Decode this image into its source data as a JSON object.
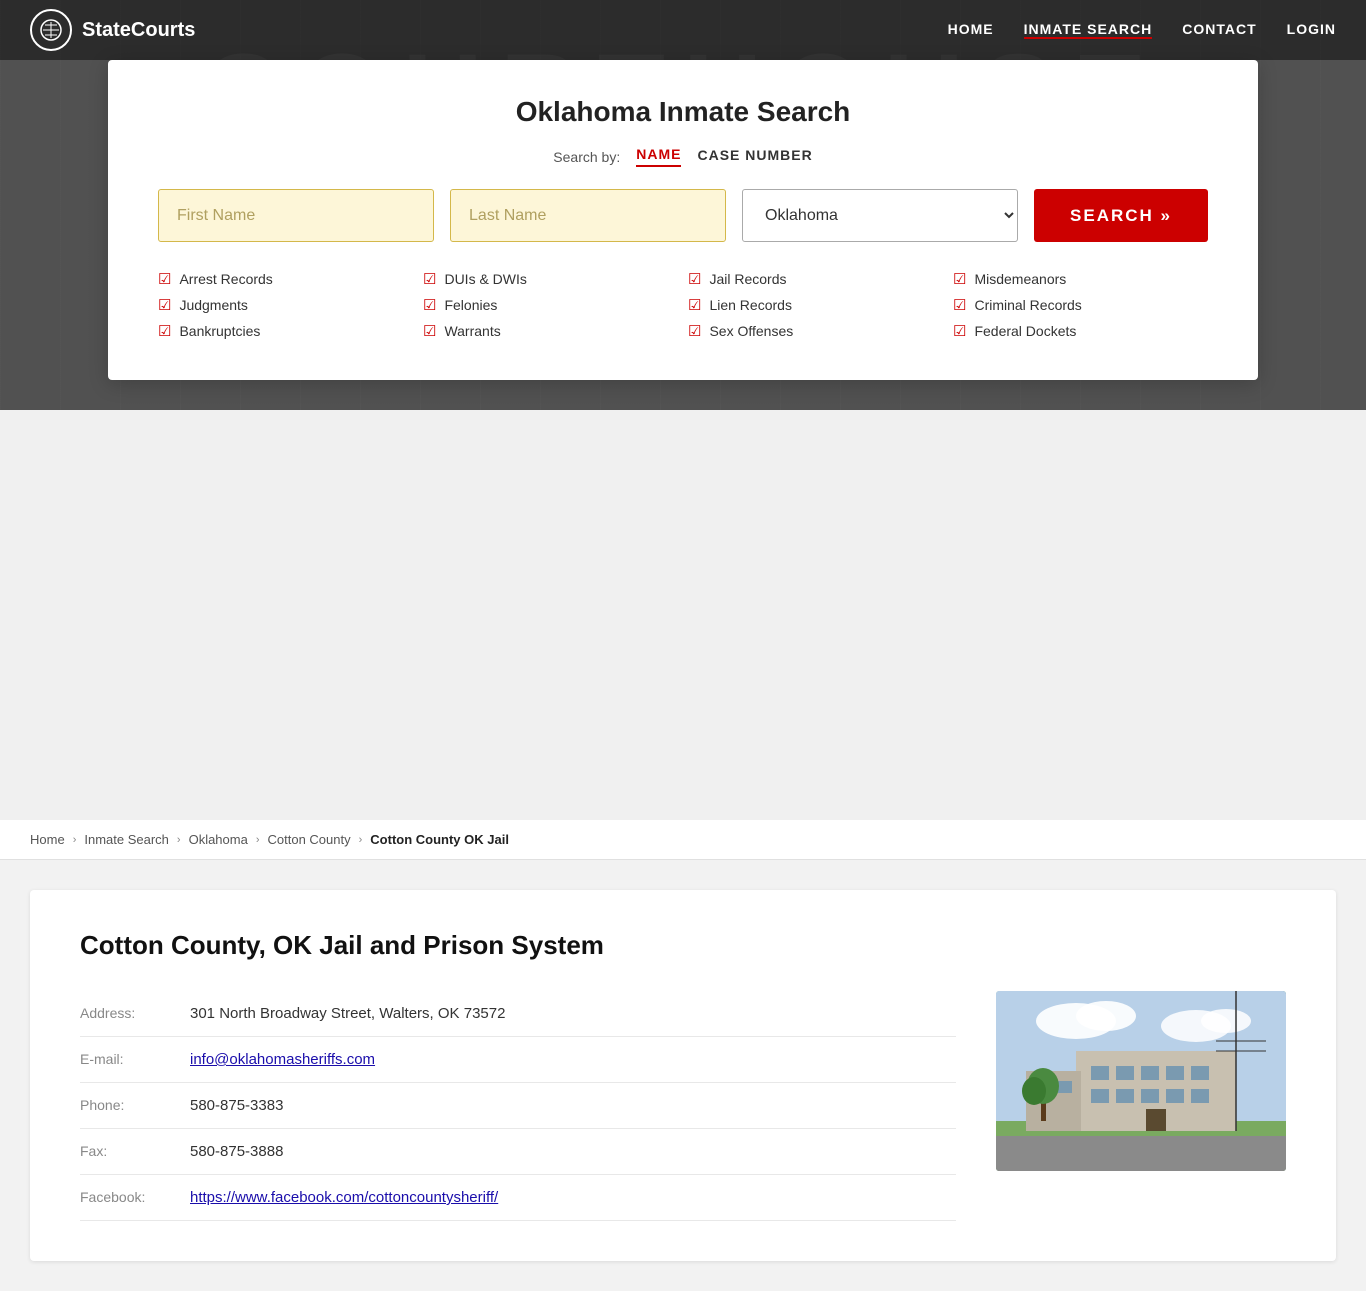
{
  "site": {
    "name": "StateCourts"
  },
  "nav": {
    "links": [
      {
        "label": "HOME",
        "href": "#",
        "active": false
      },
      {
        "label": "INMATE SEARCH",
        "href": "#",
        "active": true
      },
      {
        "label": "CONTACT",
        "href": "#",
        "active": false
      },
      {
        "label": "LOGIN",
        "href": "#",
        "active": false
      }
    ]
  },
  "hero": {
    "courthouse_text": "COURTHOUSE"
  },
  "search_card": {
    "title": "Oklahoma Inmate Search",
    "search_by_label": "Search by:",
    "tabs": [
      {
        "label": "NAME",
        "active": true
      },
      {
        "label": "CASE NUMBER",
        "active": false
      }
    ],
    "inputs": {
      "first_name_placeholder": "First Name",
      "last_name_placeholder": "Last Name",
      "state_value": "Oklahoma"
    },
    "search_button": "SEARCH »",
    "features": [
      "Arrest Records",
      "DUIs & DWIs",
      "Jail Records",
      "Misdemeanors",
      "Judgments",
      "Felonies",
      "Lien Records",
      "Criminal Records",
      "Bankruptcies",
      "Warrants",
      "Sex Offenses",
      "Federal Dockets"
    ]
  },
  "breadcrumb": {
    "items": [
      {
        "label": "Home",
        "href": "#"
      },
      {
        "label": "Inmate Search",
        "href": "#"
      },
      {
        "label": "Oklahoma",
        "href": "#"
      },
      {
        "label": "Cotton County",
        "href": "#"
      },
      {
        "label": "Cotton County OK Jail",
        "current": true
      }
    ]
  },
  "facility": {
    "title": "Cotton County, OK Jail and Prison System",
    "fields": [
      {
        "label": "Address:",
        "value": "301 North Broadway Street, Walters, OK 73572",
        "link": false
      },
      {
        "label": "E-mail:",
        "value": "info@oklahomasheriffs.com",
        "link": true
      },
      {
        "label": "Phone:",
        "value": "580-875-3383",
        "link": false
      },
      {
        "label": "Fax:",
        "value": "580-875-3888",
        "link": false
      },
      {
        "label": "Facebook:",
        "value": "https://www.facebook.com/cottoncountysheriff/",
        "link": true
      }
    ]
  }
}
